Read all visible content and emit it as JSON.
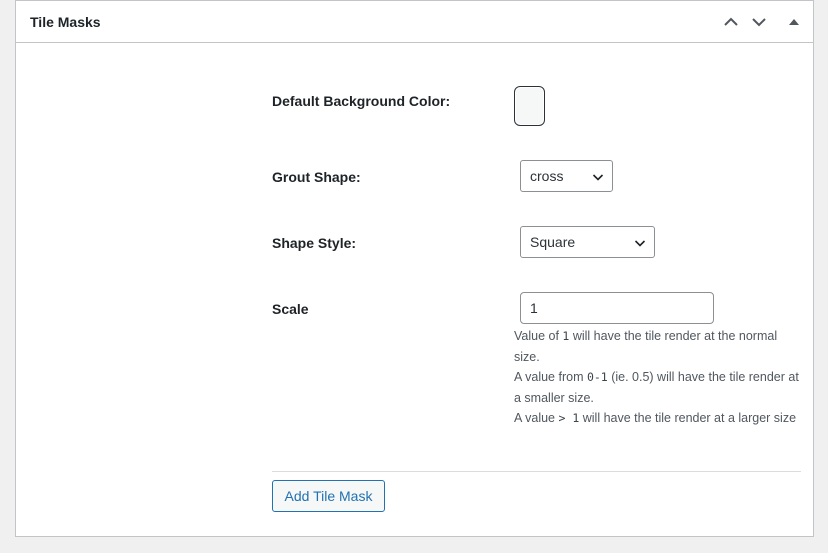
{
  "panel": {
    "title": "Tile Masks",
    "controls": {
      "move_up_icon": "chevron-up-icon",
      "move_down_icon": "chevron-down-icon",
      "toggle_icon": "triangle-up-icon"
    }
  },
  "fields": {
    "background_color": {
      "label": "Default Background Color:",
      "value_color": "#f6f7f7"
    },
    "grout_shape": {
      "label": "Grout Shape:",
      "selected": "cross"
    },
    "shape_style": {
      "label": "Shape Style:",
      "selected": "Square"
    },
    "scale": {
      "label": "Scale",
      "value": "1",
      "desc": {
        "line1_pre": "Value of ",
        "line1_code": "1",
        "line1_post": " will have the tile render at the normal size.",
        "line2_pre": "A value from ",
        "line2_code": "0-1",
        "line2_post": " (ie. 0.5) will have the tile render at a smaller size.",
        "line3_pre": "A value ",
        "line3_code": "> 1",
        "line3_post": " will have the tile render at a larger size"
      }
    }
  },
  "actions": {
    "add_label": "Add Tile Mask"
  },
  "colors": {
    "accent": "#2271b1",
    "border": "#c3c4c7",
    "background": "#f0f0f1"
  }
}
